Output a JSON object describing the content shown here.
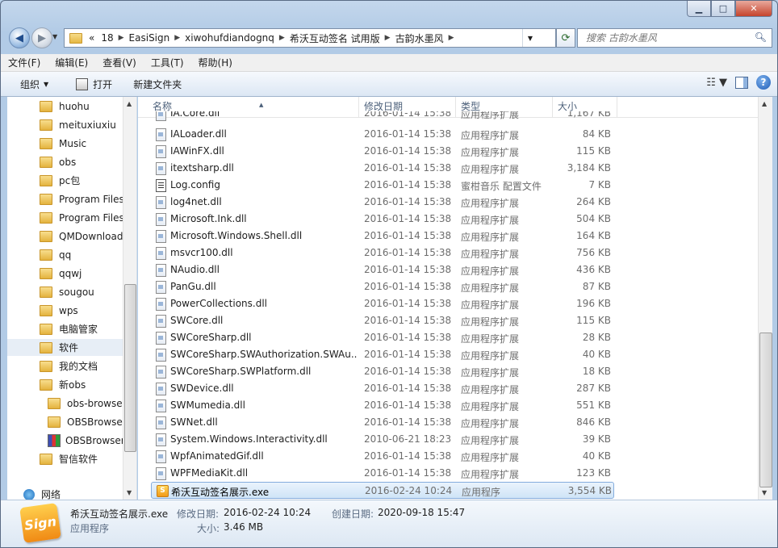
{
  "window": {
    "min": "▁",
    "max": "□",
    "close": "✕"
  },
  "address": {
    "overflow": "«",
    "segments": [
      "18",
      "EasiSign",
      "xiwohufdiandognq",
      "希沃互动签名 试用版",
      "古韵水墨风"
    ],
    "search_placeholder": "搜索 古韵水墨风"
  },
  "menu": [
    "文件(F)",
    "编辑(E)",
    "查看(V)",
    "工具(T)",
    "帮助(H)"
  ],
  "toolbar": {
    "organize": "组织",
    "open": "打开",
    "new_folder": "新建文件夹"
  },
  "nav": {
    "items": [
      {
        "label": "huohu",
        "icon": "folder-icon"
      },
      {
        "label": "meituxiuxiu",
        "icon": "folder-icon"
      },
      {
        "label": "Music",
        "icon": "folder-icon"
      },
      {
        "label": "obs",
        "icon": "folder-icon"
      },
      {
        "label": "pc包",
        "icon": "folder-icon"
      },
      {
        "label": "Program Files",
        "icon": "folder-icon"
      },
      {
        "label": "Program Files",
        "icon": "folder-icon"
      },
      {
        "label": "QMDownload",
        "icon": "folder-icon"
      },
      {
        "label": "qq",
        "icon": "folder-icon"
      },
      {
        "label": "qqwj",
        "icon": "folder-icon"
      },
      {
        "label": "sougou",
        "icon": "folder-icon"
      },
      {
        "label": "wps",
        "icon": "folder-icon"
      },
      {
        "label": "电脑管家",
        "icon": "folder-icon"
      },
      {
        "label": "软件",
        "icon": "folder-icon",
        "selected": true
      },
      {
        "label": "我的文档",
        "icon": "folder-icon"
      },
      {
        "label": "新obs",
        "icon": "folder-icon"
      },
      {
        "label": "obs-browser",
        "icon": "folder-icon",
        "indent": 1
      },
      {
        "label": "OBSBrowser",
        "icon": "folder-icon",
        "indent": 1
      },
      {
        "label": "OBSBrowser",
        "icon": "rar-icon",
        "indent": 1
      },
      {
        "label": "智信软件",
        "icon": "folder-icon"
      }
    ],
    "network": "网络"
  },
  "columns": {
    "name": "名称",
    "date": "修改日期",
    "type": "类型",
    "size": "大小"
  },
  "partial_row": {
    "name": "IA.Core.dll",
    "date": "2016-01-14 15:38",
    "type": "应用程序扩展",
    "size": "1,167 KB"
  },
  "files": [
    {
      "name": "IALoader.dll",
      "date": "2016-01-14 15:38",
      "type": "应用程序扩展",
      "size": "84 KB",
      "icon": "dll"
    },
    {
      "name": "IAWinFX.dll",
      "date": "2016-01-14 15:38",
      "type": "应用程序扩展",
      "size": "115 KB",
      "icon": "dll"
    },
    {
      "name": "itextsharp.dll",
      "date": "2016-01-14 15:38",
      "type": "应用程序扩展",
      "size": "3,184 KB",
      "icon": "dll"
    },
    {
      "name": "Log.config",
      "date": "2016-01-14 15:38",
      "type": "蜜柑音乐 配置文件",
      "size": "7 KB",
      "icon": "config"
    },
    {
      "name": "log4net.dll",
      "date": "2016-01-14 15:38",
      "type": "应用程序扩展",
      "size": "264 KB",
      "icon": "dll"
    },
    {
      "name": "Microsoft.Ink.dll",
      "date": "2016-01-14 15:38",
      "type": "应用程序扩展",
      "size": "504 KB",
      "icon": "dll"
    },
    {
      "name": "Microsoft.Windows.Shell.dll",
      "date": "2016-01-14 15:38",
      "type": "应用程序扩展",
      "size": "164 KB",
      "icon": "dll"
    },
    {
      "name": "msvcr100.dll",
      "date": "2016-01-14 15:38",
      "type": "应用程序扩展",
      "size": "756 KB",
      "icon": "dll"
    },
    {
      "name": "NAudio.dll",
      "date": "2016-01-14 15:38",
      "type": "应用程序扩展",
      "size": "436 KB",
      "icon": "dll"
    },
    {
      "name": "PanGu.dll",
      "date": "2016-01-14 15:38",
      "type": "应用程序扩展",
      "size": "87 KB",
      "icon": "dll"
    },
    {
      "name": "PowerCollections.dll",
      "date": "2016-01-14 15:38",
      "type": "应用程序扩展",
      "size": "196 KB",
      "icon": "dll"
    },
    {
      "name": "SWCore.dll",
      "date": "2016-01-14 15:38",
      "type": "应用程序扩展",
      "size": "115 KB",
      "icon": "dll"
    },
    {
      "name": "SWCoreSharp.dll",
      "date": "2016-01-14 15:38",
      "type": "应用程序扩展",
      "size": "28 KB",
      "icon": "dll"
    },
    {
      "name": "SWCoreSharp.SWAuthorization.SWAu...",
      "date": "2016-01-14 15:38",
      "type": "应用程序扩展",
      "size": "40 KB",
      "icon": "dll"
    },
    {
      "name": "SWCoreSharp.SWPlatform.dll",
      "date": "2016-01-14 15:38",
      "type": "应用程序扩展",
      "size": "18 KB",
      "icon": "dll"
    },
    {
      "name": "SWDevice.dll",
      "date": "2016-01-14 15:38",
      "type": "应用程序扩展",
      "size": "287 KB",
      "icon": "dll"
    },
    {
      "name": "SWMumedia.dll",
      "date": "2016-01-14 15:38",
      "type": "应用程序扩展",
      "size": "551 KB",
      "icon": "dll"
    },
    {
      "name": "SWNet.dll",
      "date": "2016-01-14 15:38",
      "type": "应用程序扩展",
      "size": "846 KB",
      "icon": "dll"
    },
    {
      "name": "System.Windows.Interactivity.dll",
      "date": "2010-06-21 18:23",
      "type": "应用程序扩展",
      "size": "39 KB",
      "icon": "dll"
    },
    {
      "name": "WpfAnimatedGif.dll",
      "date": "2016-01-14 15:38",
      "type": "应用程序扩展",
      "size": "40 KB",
      "icon": "dll"
    },
    {
      "name": "WPFMediaKit.dll",
      "date": "2016-01-14 15:38",
      "type": "应用程序扩展",
      "size": "123 KB",
      "icon": "dll"
    },
    {
      "name": "希沃互动签名展示.exe",
      "date": "2016-02-24 10:24",
      "type": "应用程序",
      "size": "3,554 KB",
      "icon": "exe",
      "selected": true
    }
  ],
  "details": {
    "icon_text": "Sign",
    "name": "希沃互动签名展示.exe",
    "type": "应用程序",
    "modified_label": "修改日期:",
    "modified": "2016-02-24 10:24",
    "created_label": "创建日期:",
    "created": "2020-09-18 15:47",
    "size_label": "大小:",
    "size": "3.46 MB"
  },
  "colors": {
    "selection_bg": "#cfe4f7",
    "selection_border": "#84acdd",
    "header_text": "#4c607a",
    "secondary_text": "#6d6d6d"
  }
}
